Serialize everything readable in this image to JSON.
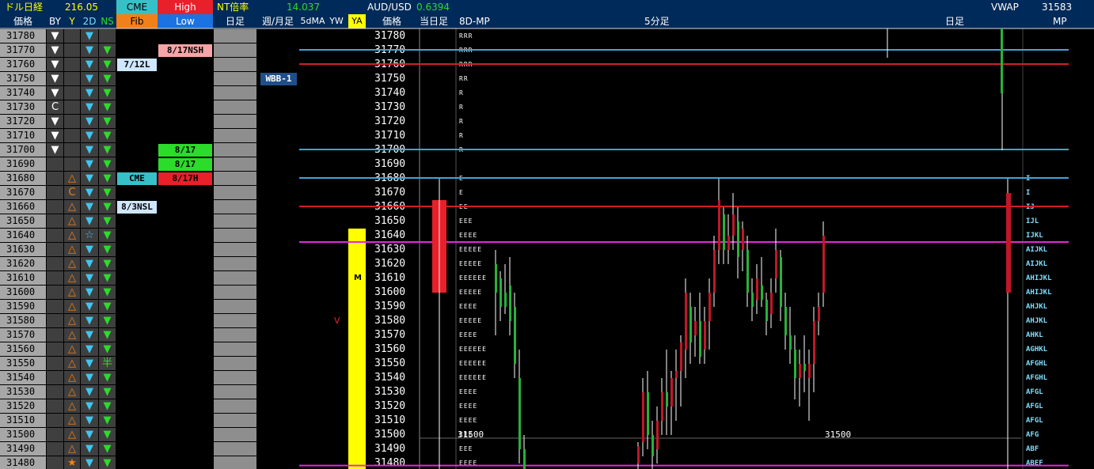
{
  "header": {
    "row1": {
      "dollar_nikkei_label": "ドル日経",
      "dollar_nikkei_value": "216.05",
      "cme": "CME",
      "high": "High",
      "nt_ratio_label": "NT倍率",
      "nt_ratio_value": "14.037",
      "audusd_label": "AUD/USD",
      "audusd_value": "0.6394",
      "vwap_label": "VWAP",
      "vwap_value": "31583"
    },
    "row2": {
      "price": "価格",
      "by": "BY",
      "y": "Y",
      "two_d": "2D",
      "ns": "NS",
      "fib": "Fib",
      "low": "Low",
      "daily": "日足",
      "weekly_monthly": "週/月足",
      "ma5d": "5dMA",
      "yw": "YW",
      "ya": "YA",
      "price2": "価格",
      "today": "当日足",
      "mp8d": "8D-MP",
      "min5": "5分足",
      "daily2": "日足",
      "mp": "MP"
    }
  },
  "colors": {
    "header_bg": "#002a59",
    "price_col_bg": "#a7a7a7",
    "ya_yellow": "#ffff00",
    "line_blue": "#3da5d9",
    "line_red": "#d01f2a",
    "line_magenta": "#e02ad6",
    "candle_up": "#c0182a",
    "candle_down": "#27b23a"
  },
  "prices": [
    "31780",
    "31770",
    "31760",
    "31750",
    "31740",
    "31730",
    "31720",
    "31710",
    "31700",
    "31690",
    "31680",
    "31670",
    "31660",
    "31650",
    "31640",
    "31630",
    "31620",
    "31610",
    "31600",
    "31590",
    "31580",
    "31570",
    "31560",
    "31550",
    "31540",
    "31530",
    "31520",
    "31510",
    "31500",
    "31490",
    "31480"
  ],
  "by_col": [
    "down",
    "down",
    "down",
    "down",
    "down",
    "C",
    "down",
    "down",
    "down",
    "",
    "",
    "",
    "",
    "",
    "",
    "",
    "",
    "",
    "",
    "",
    "",
    "",
    "",
    "",
    "",
    "",
    "",
    "",
    "",
    "",
    ""
  ],
  "y_col": [
    "",
    "",
    "",
    "",
    "",
    "",
    "",
    "",
    "",
    "",
    "tri",
    "C",
    "tri",
    "tri",
    "tri",
    "tri",
    "tri",
    "tri",
    "tri",
    "tri",
    "tri",
    "tri",
    "tri",
    "tri",
    "tri",
    "tri",
    "tri",
    "tri",
    "tri",
    "tri",
    "star"
  ],
  "two_d_col": [
    "down",
    "down",
    "down",
    "down",
    "down",
    "down",
    "down",
    "down",
    "down",
    "down",
    "down",
    "down",
    "down",
    "down",
    "star",
    "down",
    "down",
    "down",
    "down",
    "down",
    "down",
    "down",
    "down",
    "down",
    "down",
    "down",
    "down",
    "down",
    "down",
    "down",
    "down"
  ],
  "ns_col": [
    "",
    "down",
    "down",
    "down",
    "down",
    "down",
    "down",
    "down",
    "down",
    "down",
    "down",
    "down",
    "down",
    "down",
    "down",
    "down",
    "down",
    "down",
    "down",
    "down",
    "down",
    "down",
    "down",
    "半",
    "down",
    "down",
    "down",
    "down",
    "down",
    "down",
    "down"
  ],
  "fib_tags": [
    {
      "row": 2,
      "text": "7/12L",
      "color": "#000",
      "bg": "#cfe6ff"
    },
    {
      "row": 10,
      "text": "CME",
      "color": "#000",
      "bg": "#38c0c8"
    },
    {
      "row": 12,
      "text": "8/3NSL",
      "color": "#000",
      "bg": "#cfe6ff"
    }
  ],
  "low_tags": [
    {
      "row": 1,
      "text": "8/17NSH",
      "color": "#000",
      "bg": "#f5a5a8"
    },
    {
      "row": 8,
      "text": "8/17",
      "color": "#000",
      "bg": "#2bdc2b"
    },
    {
      "row": 9,
      "text": "8/17",
      "color": "#000",
      "bg": "#2bdc2b"
    },
    {
      "row": 10,
      "text": "8/17H",
      "color": "#000",
      "bg": "#e8202a"
    }
  ],
  "wk_tags": [
    {
      "row": 3,
      "text": "WBB-1",
      "color": "#fff",
      "bg": "#1f4f8a"
    }
  ],
  "ma5d_marker": {
    "row": 20,
    "text": "V"
  },
  "ya_marker": {
    "row": 17,
    "text": "M"
  },
  "mp_letters": [
    "RRR",
    "RRR",
    "RRR",
    "RR",
    "R",
    "R",
    "R",
    "R",
    "R",
    "",
    "E",
    "E",
    "EE",
    "EEE",
    "EEEE",
    "EEEEE",
    "EEEEE",
    "EEEEEE",
    "EEEEE",
    "EEEE",
    "EEEEE",
    "EEEE",
    "EEEEEE",
    "EEEEEE",
    "EEEEEE",
    "EEEE",
    "EEEE",
    "EEEE",
    "EEE",
    "EEE",
    "EEEE"
  ],
  "mp_right": [
    "",
    "",
    "",
    "",
    "",
    "",
    "",
    "",
    "",
    "",
    "I",
    "I",
    "IJ",
    "IJL",
    "IJKL",
    "AIJKL",
    "AIJKL",
    "AHIJKL",
    "AHIJKL",
    "AHJKL",
    "AHJKL",
    "AHKL",
    "AGHKL",
    "AFGHL",
    "AFGHL",
    "AFGL",
    "AFGL",
    "AFGL",
    "AFG",
    "ABF",
    "ABEF"
  ],
  "price_label_31500": "31500",
  "chart_labels": {
    "left_31500": "31500",
    "right_31500": "31500"
  }
}
